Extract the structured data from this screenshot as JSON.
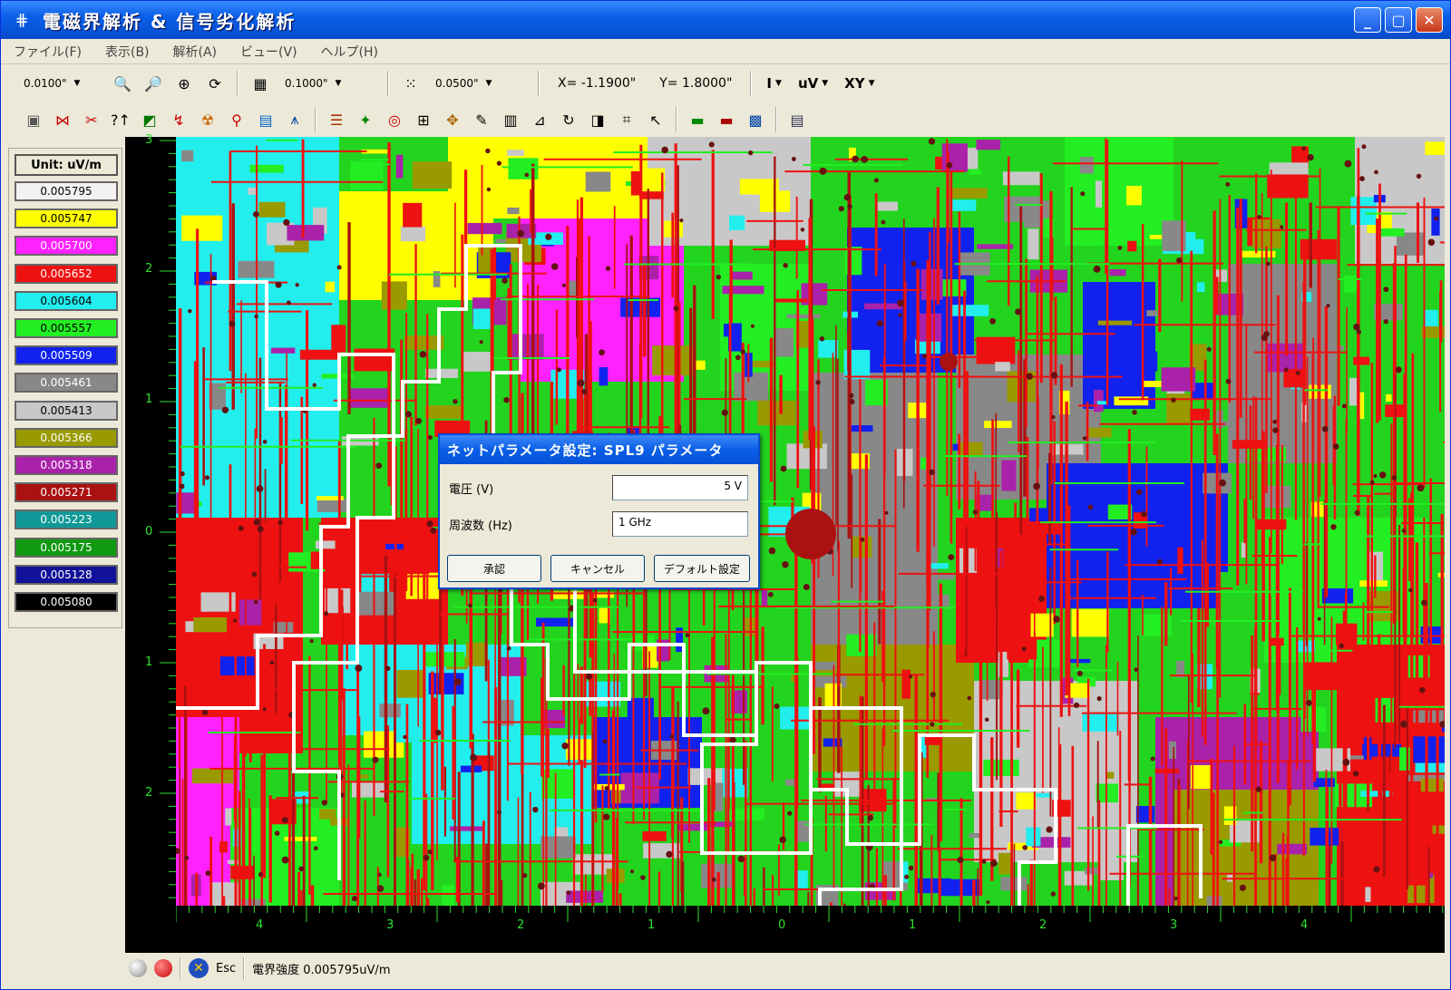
{
  "window": {
    "title": "電磁界解析 & 信号劣化解析"
  },
  "menu": [
    "ファイル(F)",
    "表示(B)",
    "解析(A)",
    "ビュー(V)",
    "ヘルプ(H)"
  ],
  "toolbar": {
    "grid_value": "0.0100\"",
    "snap_value": "0.1000\"",
    "pitch_value": "0.0500\"",
    "x_coord": "X= -1.1900\"",
    "y_coord": "Y= 1.8000\"",
    "mode_combo": "I",
    "unit_combo": "uV",
    "plane_combo": "XY"
  },
  "legend": {
    "unit": "Unit: uV/m",
    "items": [
      {
        "value": "0.005795",
        "color": "#f4f2f0",
        "text_color": "#000"
      },
      {
        "value": "0.005747",
        "color": "#ffff00",
        "text_color": "#000"
      },
      {
        "value": "0.005700",
        "color": "#ff22ff",
        "text_color": "#fff"
      },
      {
        "value": "0.005652",
        "color": "#ee1111",
        "text_color": "#fff"
      },
      {
        "value": "0.005604",
        "color": "#22eeee",
        "text_color": "#000"
      },
      {
        "value": "0.005557",
        "color": "#22ee22",
        "text_color": "#000"
      },
      {
        "value": "0.005509",
        "color": "#1122ee",
        "text_color": "#fff"
      },
      {
        "value": "0.005461",
        "color": "#888888",
        "text_color": "#fff"
      },
      {
        "value": "0.005413",
        "color": "#c8c8c8",
        "text_color": "#000"
      },
      {
        "value": "0.005366",
        "color": "#999900",
        "text_color": "#fff"
      },
      {
        "value": "0.005318",
        "color": "#aa22aa",
        "text_color": "#fff"
      },
      {
        "value": "0.005271",
        "color": "#aa1111",
        "text_color": "#fff"
      },
      {
        "value": "0.005223",
        "color": "#119999",
        "text_color": "#fff"
      },
      {
        "value": "0.005175",
        "color": "#119911",
        "text_color": "#fff"
      },
      {
        "value": "0.005128",
        "color": "#111199",
        "text_color": "#fff"
      },
      {
        "value": "0.005080",
        "color": "#000000",
        "text_color": "#fff"
      }
    ]
  },
  "rulers": {
    "vertical": [
      "3",
      "2",
      "1",
      "0",
      "1",
      "2"
    ],
    "horizontal": [
      "4",
      "3",
      "2",
      "1",
      "0",
      "1",
      "2",
      "3",
      "4"
    ]
  },
  "dialog": {
    "title": "ネットパラメータ設定: SPL9 パラメータ",
    "voltage_label": "電圧 (V)",
    "voltage_value": "5 V",
    "frequency_label": "周波数 (Hz)",
    "frequency_value": "1 GHz",
    "ok_label": "承認",
    "cancel_label": "キャンセル",
    "default_label": "デフォルト設定"
  },
  "status": {
    "esc_label": "Esc",
    "field_text": "電界強度 0.005795uV/m"
  }
}
